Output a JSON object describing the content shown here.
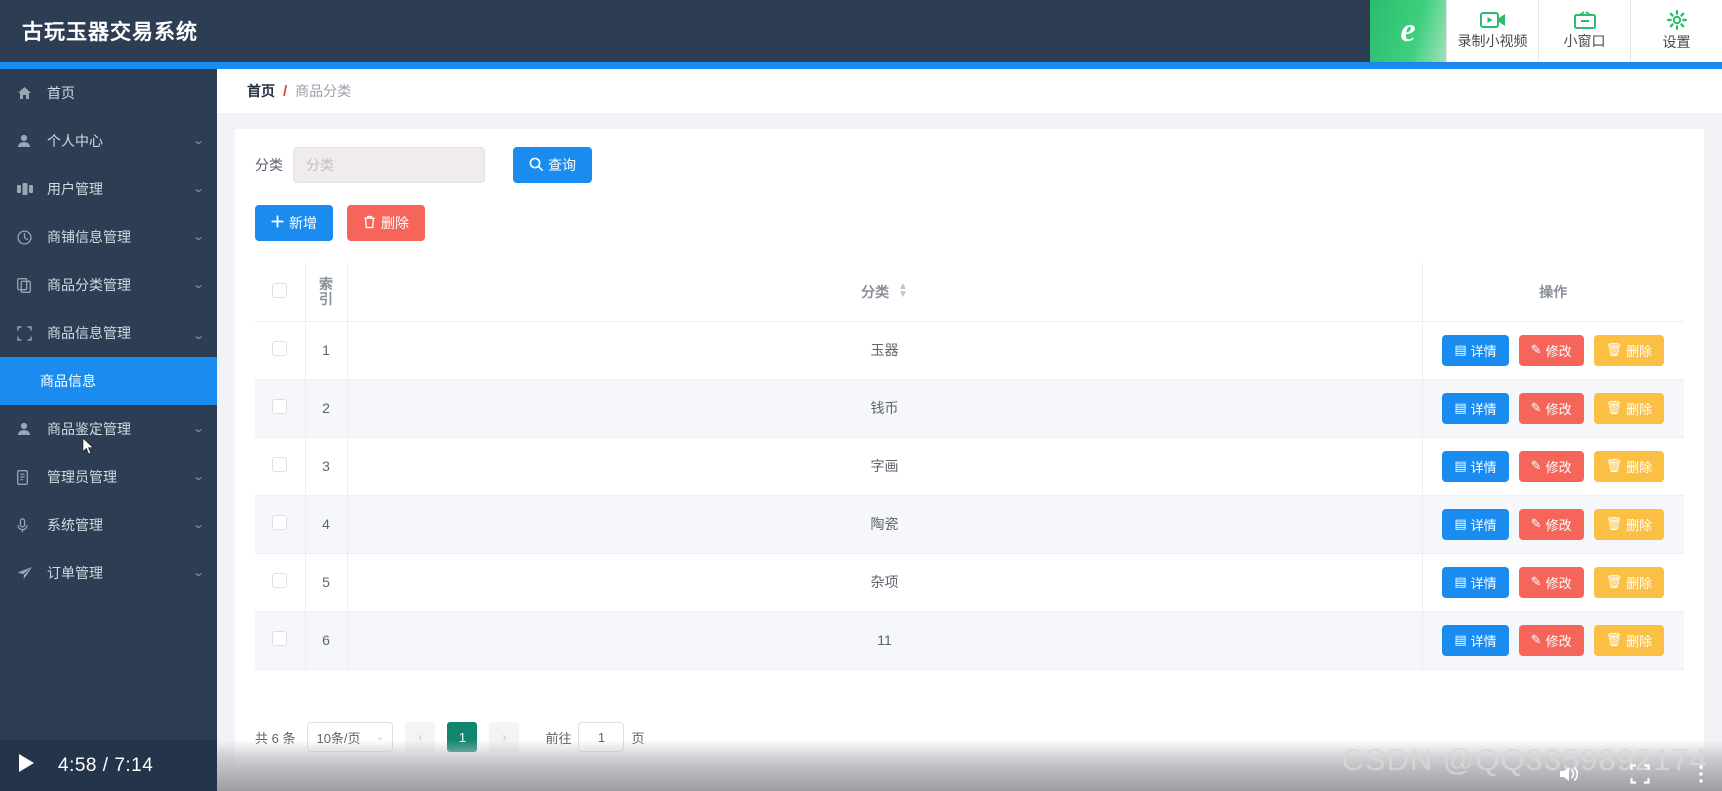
{
  "header": {
    "brand": "古玩玉器交易系统"
  },
  "recorder": {
    "logo_glyph": "e",
    "items": [
      {
        "icon": "video-camera-icon",
        "label": "录制小视频"
      },
      {
        "icon": "small-window-icon",
        "label": "小窗口"
      },
      {
        "icon": "gear-icon",
        "label": "设置"
      }
    ]
  },
  "sidebar": {
    "items": [
      {
        "icon": "home-icon",
        "label": "首页",
        "arrow": "",
        "expandable": false
      },
      {
        "icon": "user-icon",
        "label": "个人中心",
        "arrow": "⌄",
        "expandable": true
      },
      {
        "icon": "users-icon",
        "label": "用户管理",
        "arrow": "⌄",
        "expandable": true
      },
      {
        "icon": "clock-icon",
        "label": "商铺信息管理",
        "arrow": "⌄",
        "expandable": true
      },
      {
        "icon": "copy-icon",
        "label": "商品分类管理",
        "arrow": "⌄",
        "expandable": true
      },
      {
        "icon": "crop-icon",
        "label": "商品信息管理",
        "arrow": "⌃",
        "expandable": true
      },
      {
        "icon": "person-icon",
        "label": "商品鉴定管理",
        "arrow": "⌄",
        "expandable": true
      },
      {
        "icon": "id-card-icon",
        "label": "管理员管理",
        "arrow": "⌄",
        "expandable": true
      },
      {
        "icon": "mic-icon",
        "label": "系统管理",
        "arrow": "⌄",
        "expandable": true
      },
      {
        "icon": "send-icon",
        "label": "订单管理",
        "arrow": "⌄",
        "expandable": true
      }
    ],
    "submenu_active": "商品信息"
  },
  "breadcrumb": {
    "home": "首页",
    "separator": "/",
    "current": "商品分类"
  },
  "filter": {
    "label": "分类",
    "placeholder": "分类",
    "value": "",
    "query_button": "查询",
    "query_icon": "search-icon"
  },
  "actions": {
    "add_label": "新增",
    "add_icon": "plus-icon",
    "delete_label": "删除",
    "delete_icon": "trash-icon"
  },
  "table": {
    "columns": {
      "index": "索引",
      "category": "分类",
      "operation": "操作"
    },
    "sortable_column": "分类",
    "rows": [
      {
        "index": "1",
        "category": "玉器"
      },
      {
        "index": "2",
        "category": "钱币"
      },
      {
        "index": "3",
        "category": "字画"
      },
      {
        "index": "4",
        "category": "陶瓷"
      },
      {
        "index": "5",
        "category": "杂项"
      },
      {
        "index": "6",
        "category": "11"
      }
    ],
    "row_actions": {
      "detail": "详情",
      "edit": "修改",
      "delete": "删除"
    }
  },
  "pagination": {
    "total_text": "共 6 条",
    "page_size": "10条/页",
    "current_page": "1",
    "jump_prefix": "前往",
    "jump_value": "1",
    "jump_suffix": "页"
  },
  "player": {
    "time": "4:58 / 7:14",
    "watermark": "CSDN @QQ3359892174"
  },
  "colors": {
    "header_bg": "#2d3e54",
    "accent_blue": "#1a8cf0",
    "danger_red": "#f5655a",
    "warn_yellow": "#fbbf43",
    "pager_active": "#11866f",
    "breadcrumb_sep": "#e8413a"
  }
}
